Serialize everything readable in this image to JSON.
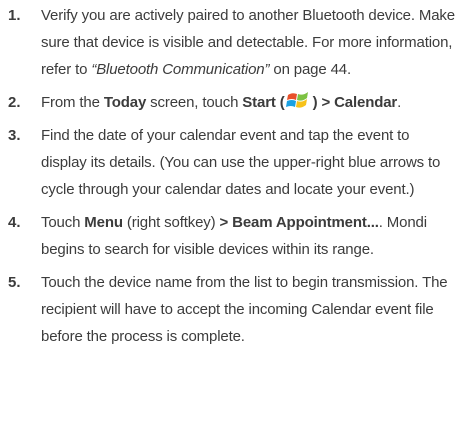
{
  "steps": [
    {
      "number": "1.",
      "text_a": "Verify you are actively paired to another Bluetooth device. Make sure that device is visible and detectable. For more information, refer to ",
      "link": "“Bluetooth Communication”",
      "text_b": " on page 44."
    },
    {
      "number": "2.",
      "text_a": "From the ",
      "today": "Today",
      "text_b": " screen, touch ",
      "start": "Start",
      "paren_open": " (",
      "icon": "windows-start-icon",
      "paren_close": ") ",
      "arrow_target": "> Calendar",
      "end": "."
    },
    {
      "number": "3.",
      "text": "Find the date of your calendar event and tap the event to display its details. (You can use the upper-right blue arrows to cycle through your calendar dates and locate your event.)"
    },
    {
      "number": "4.",
      "text_a": "Touch ",
      "menu": "Menu",
      "text_b": " (right softkey) ",
      "beam": "> Beam Appointment...",
      "text_c": ". Mondi begins to search for visible devices within its range."
    },
    {
      "number": "5.",
      "text": "Touch the device name from the list to begin transmission. The recipient will have to accept the incoming Calendar event file before the process is complete."
    }
  ],
  "colors": {
    "text": "#3c3c3c",
    "win_red": "#e8502a",
    "win_green": "#7dc242",
    "win_blue": "#1ba1e2",
    "win_yellow": "#f7c21a"
  }
}
